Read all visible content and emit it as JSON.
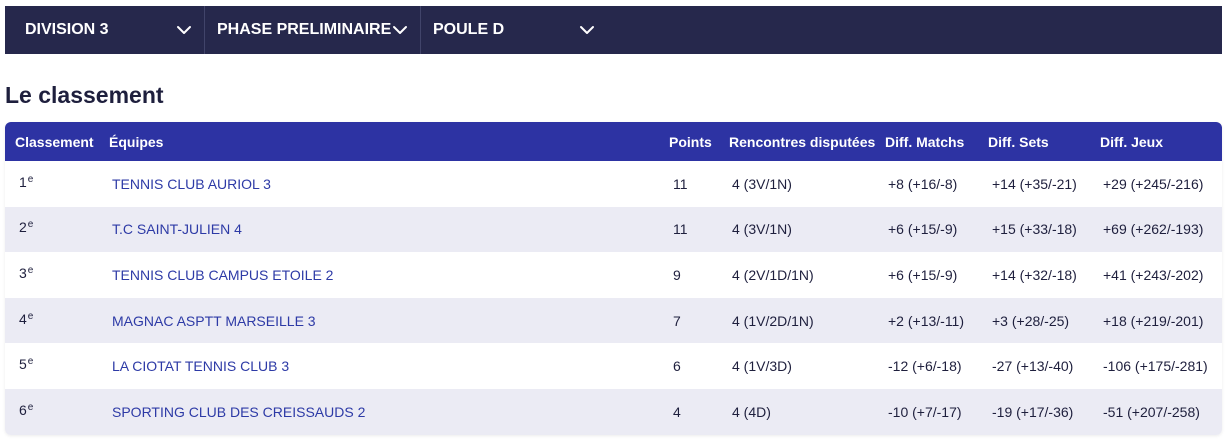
{
  "filters": [
    {
      "label": "DIVISION 3"
    },
    {
      "label": "PHASE PRELIMINAIRE"
    },
    {
      "label": "POULE D"
    }
  ],
  "section_title": "Le classement",
  "table": {
    "headers": {
      "rank": "Classement",
      "team": "Équipes",
      "points": "Points",
      "rencontres": "Rencontres disputées",
      "diff_matchs": "Diff. Matchs",
      "diff_sets": "Diff. Sets",
      "diff_jeux": "Diff. Jeux"
    },
    "rows": [
      {
        "rank": "1",
        "suffix": "e",
        "team": "TENNIS CLUB AURIOL 3",
        "points": "11",
        "rencontres": "4 (3V/1N)",
        "diff_matchs": "+8 (+16/-8)",
        "diff_sets": "+14 (+35/-21)",
        "diff_jeux": "+29 (+245/-216)"
      },
      {
        "rank": "2",
        "suffix": "e",
        "team": "T.C SAINT-JULIEN 4",
        "points": "11",
        "rencontres": "4 (3V/1N)",
        "diff_matchs": "+6 (+15/-9)",
        "diff_sets": "+15 (+33/-18)",
        "diff_jeux": "+69 (+262/-193)"
      },
      {
        "rank": "3",
        "suffix": "e",
        "team": "TENNIS CLUB CAMPUS ETOILE 2",
        "points": "9",
        "rencontres": "4 (2V/1D/1N)",
        "diff_matchs": "+6 (+15/-9)",
        "diff_sets": "+14 (+32/-18)",
        "diff_jeux": "+41 (+243/-202)"
      },
      {
        "rank": "4",
        "suffix": "e",
        "team": "MAGNAC ASPTT MARSEILLE 3",
        "points": "7",
        "rencontres": "4 (1V/2D/1N)",
        "diff_matchs": "+2 (+13/-11)",
        "diff_sets": "+3 (+28/-25)",
        "diff_jeux": "+18 (+219/-201)"
      },
      {
        "rank": "5",
        "suffix": "e",
        "team": "LA CIOTAT TENNIS CLUB 3",
        "points": "6",
        "rencontres": "4 (1V/3D)",
        "diff_matchs": "-12 (+6/-18)",
        "diff_sets": "-27 (+13/-40)",
        "diff_jeux": "-106 (+175/-281)"
      },
      {
        "rank": "6",
        "suffix": "e",
        "team": "SPORTING CLUB DES CREISSAUDS 2",
        "points": "4",
        "rencontres": "4 (4D)",
        "diff_matchs": "-10 (+7/-17)",
        "diff_sets": "-19 (+17/-36)",
        "diff_jeux": "-51 (+207/-258)"
      }
    ]
  },
  "colors": {
    "filter_bar": "#26284c",
    "table_header": "#2d33a3",
    "team_link": "#2d3aa6",
    "row_alt": "#ebebf4"
  },
  "icons": {
    "dropdown": "chevron-down-icon"
  }
}
